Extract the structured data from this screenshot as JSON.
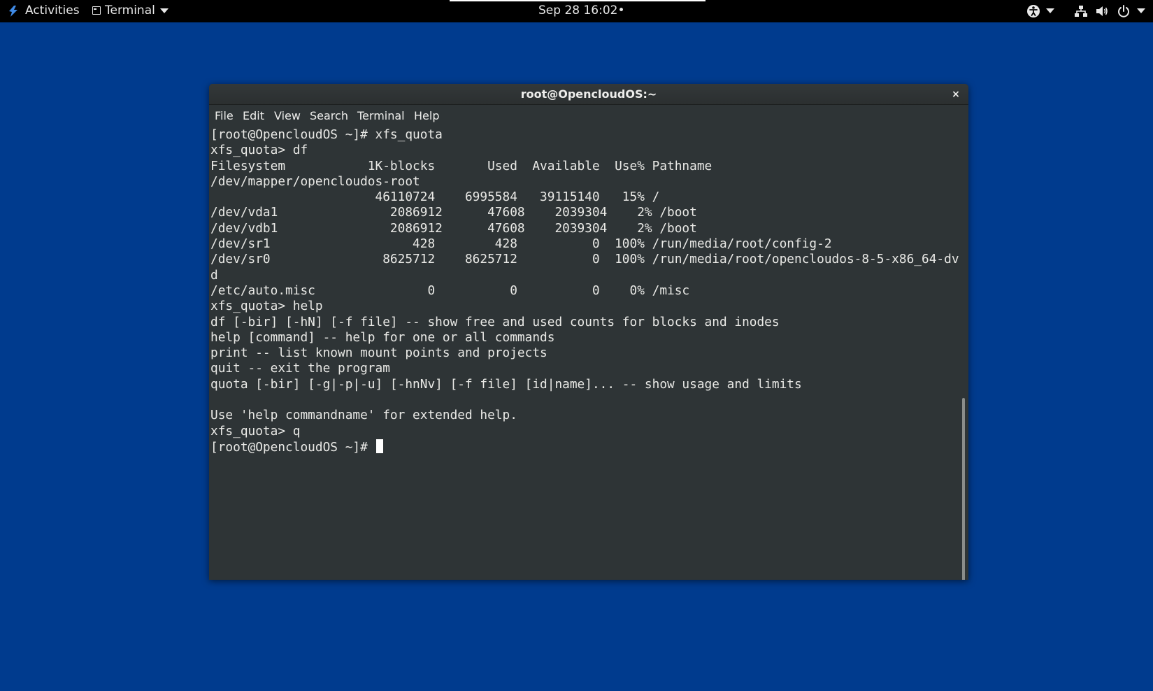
{
  "topbar": {
    "activities_label": "Activities",
    "app_label": "Terminal",
    "clock": "Sep 28  16:02•",
    "icons": [
      "accessibility-icon",
      "network-icon",
      "volume-icon",
      "power-icon"
    ]
  },
  "window": {
    "title": "root@OpencloudOS:~",
    "close_glyph": "×",
    "menus": [
      "File",
      "Edit",
      "View",
      "Search",
      "Terminal",
      "Help"
    ]
  },
  "terminal": {
    "lines": [
      "[root@OpencloudOS ~]# xfs_quota",
      "xfs_quota> df",
      "Filesystem           1K-blocks       Used  Available  Use% Pathname",
      "/dev/mapper/opencloudos-root",
      "                      46110724    6995584   39115140   15% /",
      "/dev/vda1               2086912      47608    2039304    2% /boot",
      "/dev/vdb1               2086912      47608    2039304    2% /boot",
      "/dev/sr1                   428        428          0  100% /run/media/root/config-2",
      "/dev/sr0               8625712    8625712          0  100% /run/media/root/opencloudos-8-5-x86_64-dv",
      "d",
      "/etc/auto.misc               0          0          0    0% /misc",
      "xfs_quota> help",
      "df [-bir] [-hN] [-f file] -- show free and used counts for blocks and inodes",
      "help [command] -- help for one or all commands",
      "print -- list known mount points and projects",
      "quit -- exit the program",
      "quota [-bir] [-g|-p|-u] [-hnNv] [-f file] [id|name]... -- show usage and limits",
      "",
      "Use 'help commandname' for extended help.",
      "xfs_quota> q"
    ],
    "prompt": "[root@OpencloudOS ~]# "
  },
  "colors": {
    "desktop": "#003b8e",
    "terminal_bg": "#2e3436",
    "terminal_fg": "#e9e9e6",
    "topbar_bg": "#000000"
  }
}
